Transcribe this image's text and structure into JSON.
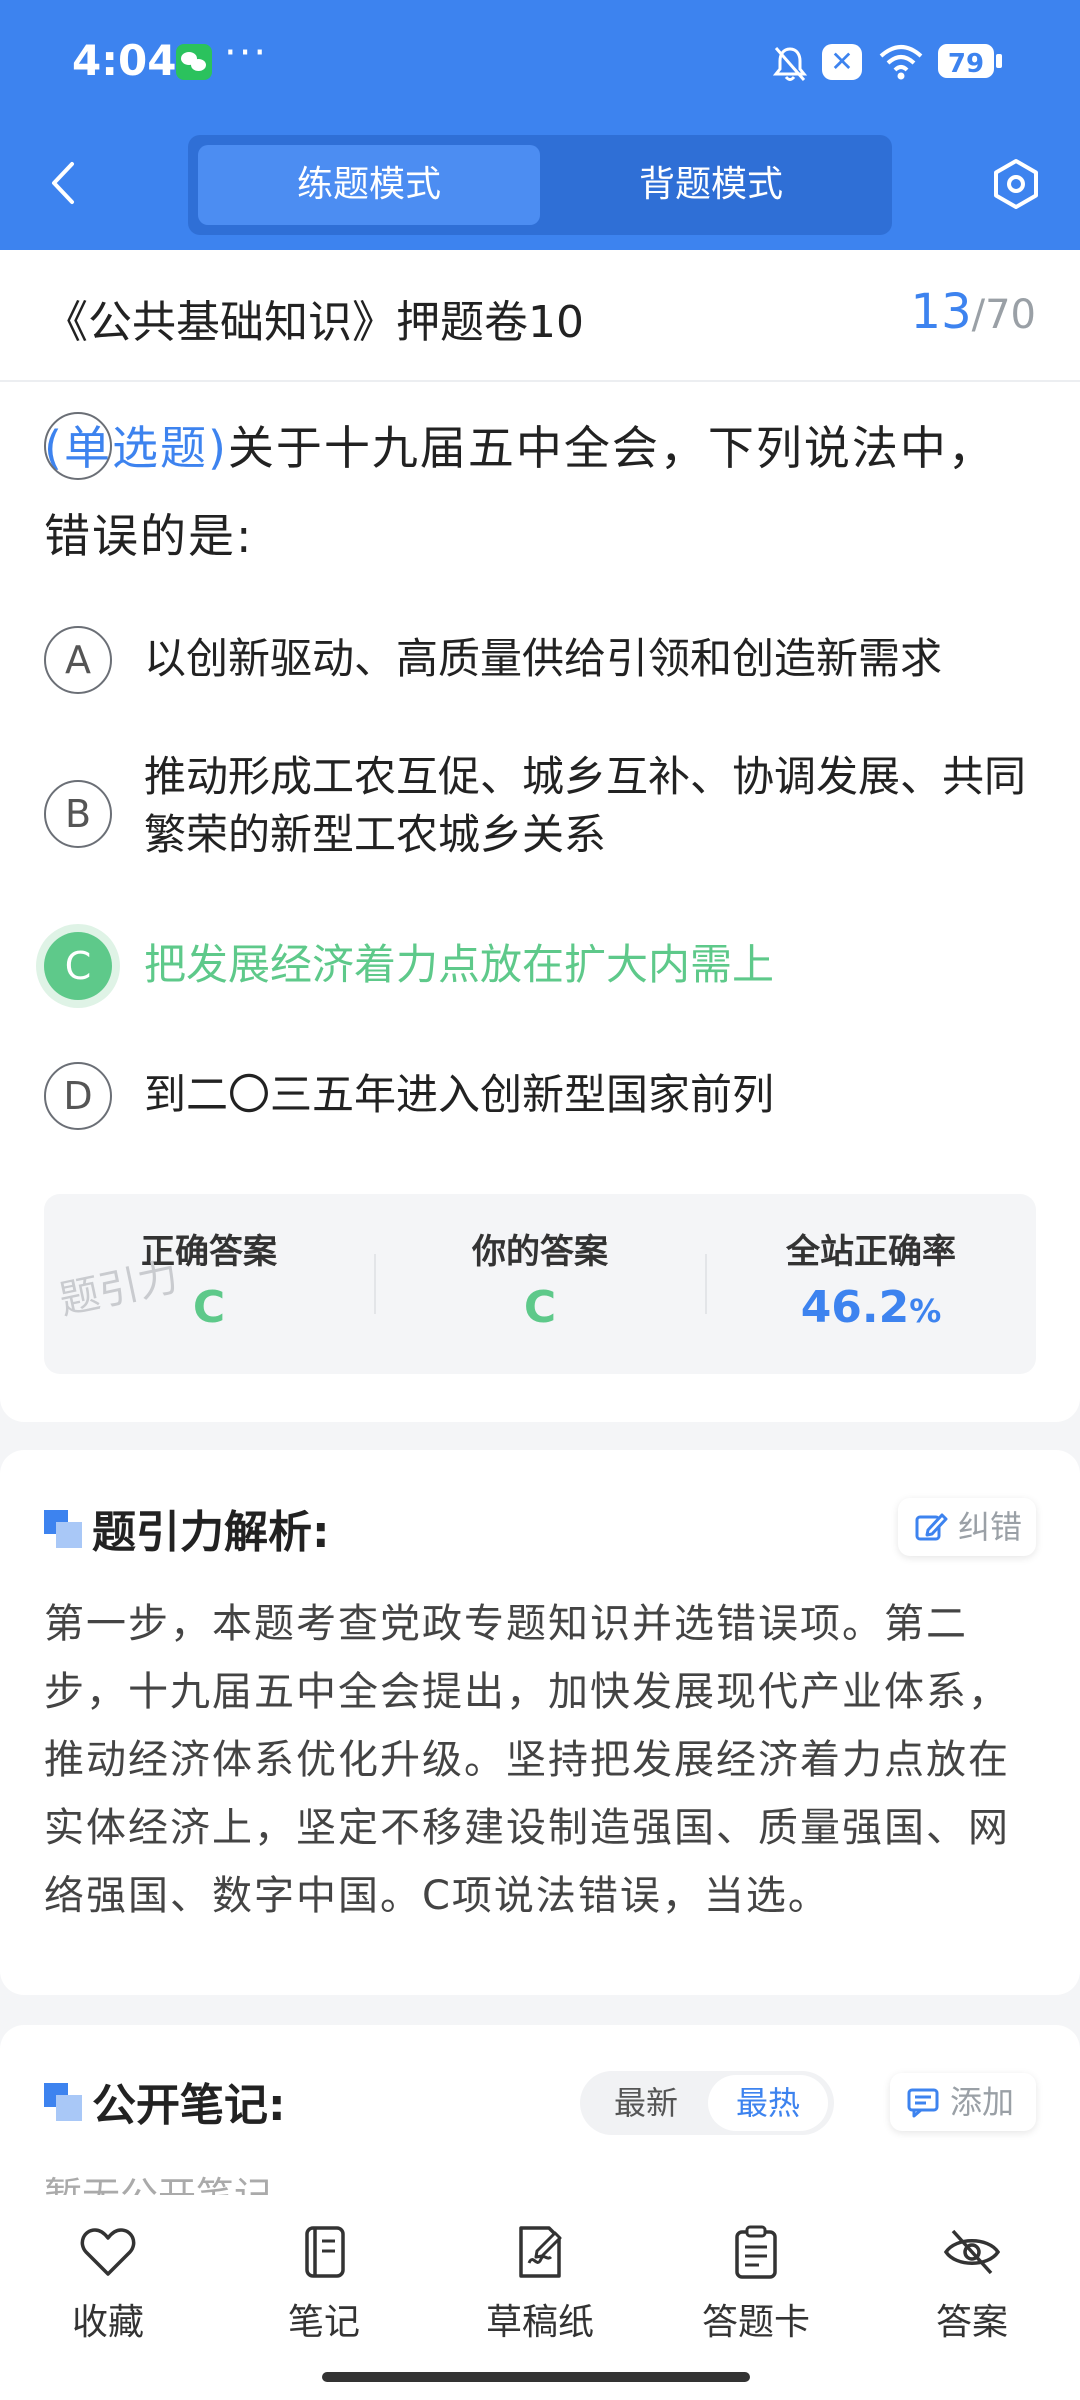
{
  "status": {
    "time": "4:04",
    "dots": "···",
    "battery": "79"
  },
  "header": {
    "tabs": [
      {
        "label": "练题模式",
        "active": true
      },
      {
        "label": "背题模式",
        "active": false
      }
    ]
  },
  "exam": {
    "title": "《公共基础知识》押题卷10",
    "current": "13",
    "separator": "/",
    "total": "70"
  },
  "question": {
    "type": "(单选题)",
    "text": "关于十九届五中全会，下列说法中，错误的是:",
    "options": [
      {
        "letter": "A",
        "text": "以创新驱动、高质量供给引领和创造新需求"
      },
      {
        "letter": "B",
        "text": "推动形成工农互促、城乡互补、协调发展、共同繁荣的新型工农城乡关系"
      },
      {
        "letter": "C",
        "text": "把发展经济着力点放在扩大内需上",
        "selected": true
      },
      {
        "letter": "D",
        "text": "到二〇三五年进入创新型国家前列"
      }
    ]
  },
  "stats": {
    "correct_label": "正确答案",
    "correct_value": "C",
    "yours_label": "你的答案",
    "yours_value": "C",
    "rate_label": "全站正确率",
    "rate_value": "46.2",
    "rate_unit": "%",
    "watermark": "题引力"
  },
  "analysis": {
    "title": "题引力解析:",
    "correct_button": "纠错",
    "text": "第一步，本题考查党政专题知识并选错误项。第二步，十九届五中全会提出，加快发展现代产业体系，推动经济体系优化升级。坚持把发展经济着力点放在实体经济上，坚定不移建设制造强国、质量强国、网络强国、数字中国。C项说法错误，当选。"
  },
  "notes": {
    "title": "公开笔记:",
    "sort_latest": "最新",
    "sort_hot": "最热",
    "add_button": "添加",
    "empty": "暂无公开笔记"
  },
  "bottom_bar": [
    {
      "label": "收藏",
      "icon": "heart-icon"
    },
    {
      "label": "笔记",
      "icon": "notebook-icon"
    },
    {
      "label": "草稿纸",
      "icon": "draft-icon"
    },
    {
      "label": "答题卡",
      "icon": "answer-sheet-icon"
    },
    {
      "label": "答案",
      "icon": "eye-off-icon"
    }
  ],
  "colors": {
    "primary": "#3d83ef",
    "correct": "#5ec98a"
  }
}
